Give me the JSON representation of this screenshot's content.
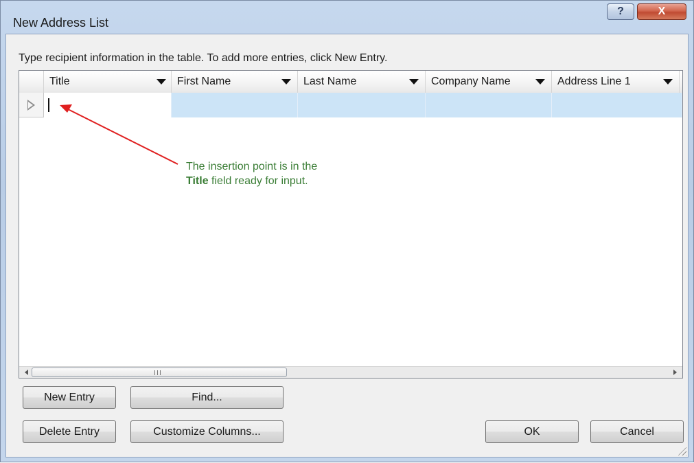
{
  "window": {
    "title": "New Address List",
    "help_label": "?",
    "close_label": "X"
  },
  "instruction": "Type recipient information in the table.  To add more entries, click New Entry.",
  "columns": [
    {
      "label": "Title"
    },
    {
      "label": "First Name"
    },
    {
      "label": "Last Name"
    },
    {
      "label": "Company Name"
    },
    {
      "label": "Address Line 1"
    }
  ],
  "row": {
    "title": "",
    "first_name": "",
    "last_name": "",
    "company_name": "",
    "address_line_1": ""
  },
  "scrollbar": {
    "grip": "III"
  },
  "buttons": {
    "new_entry": "New Entry",
    "find": "Find...",
    "delete_entry": "Delete Entry",
    "customize_columns": "Customize Columns...",
    "ok": "OK",
    "cancel": "Cancel"
  },
  "annotation": {
    "line1": "The insertion point is in the",
    "bold": "Title",
    "line2_rest": " field ready for input."
  },
  "colors": {
    "selection": "#cce4f7",
    "annotation_text": "#3a7d35",
    "arrow": "#e02020"
  }
}
